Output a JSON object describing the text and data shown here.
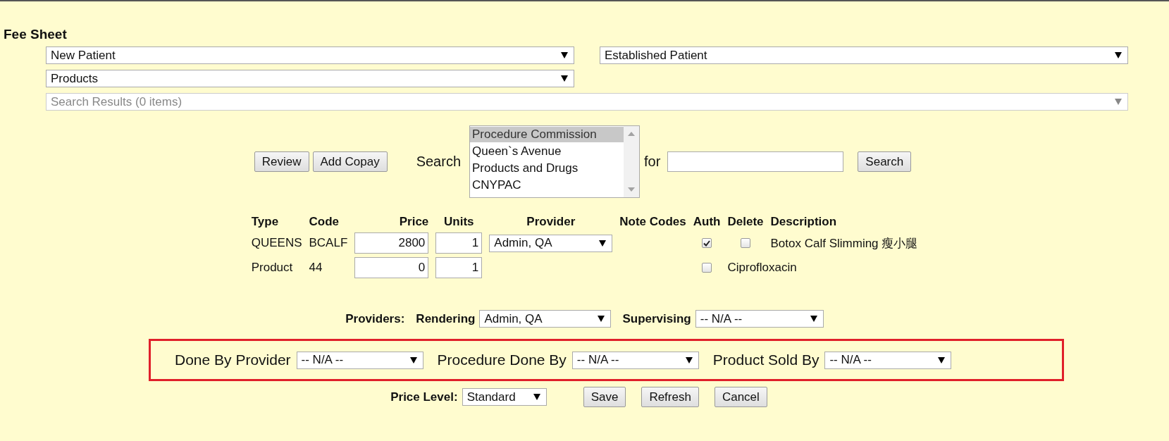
{
  "title": "Fee Sheet",
  "category_selects": [
    {
      "value": "New Patient",
      "disabled": false
    },
    {
      "value": "Established Patient",
      "disabled": false
    },
    {
      "value": "Products",
      "disabled": false
    },
    {
      "value": "Search Results (0 items)",
      "disabled": true
    }
  ],
  "actions": [
    "Review",
    "Add Copay"
  ],
  "search_label": "Search",
  "search_categories": [
    {
      "label": "Procedure Commission",
      "selected": true
    },
    {
      "label": "Queen`s Avenue",
      "selected": false
    },
    {
      "label": "Products and Drugs",
      "selected": false
    },
    {
      "label": "CNYPAC",
      "selected": false
    }
  ],
  "for_label": "for",
  "search_button": "Search",
  "table": {
    "columns": [
      "Type",
      "Code",
      "Price",
      "Units",
      "Provider",
      "Note Codes",
      "Auth",
      "Delete",
      "Description"
    ],
    "rows": [
      {
        "type": "QUEENS",
        "code": "BCALF",
        "price": "2800",
        "units": "1",
        "provider": "Admin, QA",
        "auth": true,
        "delete": false,
        "description": "Botox Calf Slimming 瘦小腿"
      },
      {
        "type": "Product",
        "code": "44",
        "price": "0",
        "units": "1",
        "auth": false,
        "description": "Ciprofloxacin"
      }
    ]
  },
  "providers": {
    "label": "Providers:",
    "rendering_label": "Rendering",
    "rendering": "Admin, QA",
    "supervising_label": "Supervising",
    "supervising": "-- N/A --"
  },
  "highlighted_fields": [
    {
      "label": "Done By Provider",
      "value": "-- N/A --"
    },
    {
      "label": "Procedure Done By",
      "value": "-- N/A --"
    },
    {
      "label": "Product Sold By",
      "value": "-- N/A --"
    }
  ],
  "price_level": {
    "label": "Price Level:",
    "value": "Standard"
  },
  "buttons": [
    "Save",
    "Refresh",
    "Cancel"
  ]
}
